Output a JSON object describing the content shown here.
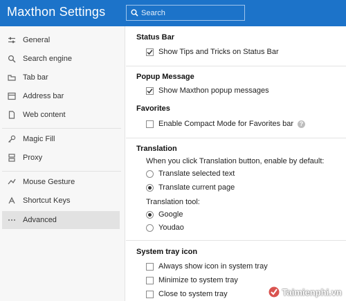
{
  "app": {
    "title": "Maxthon Settings"
  },
  "search": {
    "placeholder": "Search"
  },
  "sidebar": {
    "items": [
      {
        "label": "General",
        "icon": "sliders-icon"
      },
      {
        "label": "Search engine",
        "icon": "search-icon"
      },
      {
        "label": "Tab bar",
        "icon": "tab-icon"
      },
      {
        "label": "Address bar",
        "icon": "address-bar-icon"
      },
      {
        "label": "Web content",
        "icon": "document-icon"
      },
      {
        "label": "Magic Fill",
        "icon": "key-icon"
      },
      {
        "label": "Proxy",
        "icon": "proxy-icon"
      },
      {
        "label": "Mouse Gesture",
        "icon": "mouse-gesture-icon"
      },
      {
        "label": "Shortcut Keys",
        "icon": "keyboard-icon"
      },
      {
        "label": "Advanced",
        "icon": "ellipsis-icon"
      }
    ],
    "active": "Advanced"
  },
  "sections": {
    "status_bar": {
      "title": "Status Bar",
      "show_tips": {
        "label": "Show Tips and Tricks on Status Bar",
        "checked": true
      }
    },
    "popup": {
      "title": "Popup Message",
      "show_popup": {
        "label": "Show Maxthon popup messages",
        "checked": true
      }
    },
    "favorites": {
      "title": "Favorites",
      "compact": {
        "label": "Enable Compact Mode for Favorites bar",
        "checked": false
      },
      "help": "?"
    },
    "translation": {
      "title": "Translation",
      "prompt": "When you click Translation button, enable by default:",
      "selected_text": {
        "label": "Translate selected text",
        "selected": false
      },
      "current_page": {
        "label": "Translate current page",
        "selected": true
      },
      "tool_label": "Translation tool:",
      "google": {
        "label": "Google",
        "selected": true
      },
      "youdao": {
        "label": "Youdao",
        "selected": false
      }
    },
    "tray": {
      "title": "System tray icon",
      "always_show": {
        "label": "Always show icon in system tray",
        "checked": false
      },
      "minimize": {
        "label": "Minimize to system tray",
        "checked": false
      },
      "close": {
        "label": "Close to system tray",
        "checked": false
      }
    }
  },
  "watermark": {
    "text": "Taimienphi.vn"
  },
  "colors": {
    "header": "#1c73c9",
    "sidebar": "#f7f7f7",
    "active_item": "#e2e2e2"
  }
}
